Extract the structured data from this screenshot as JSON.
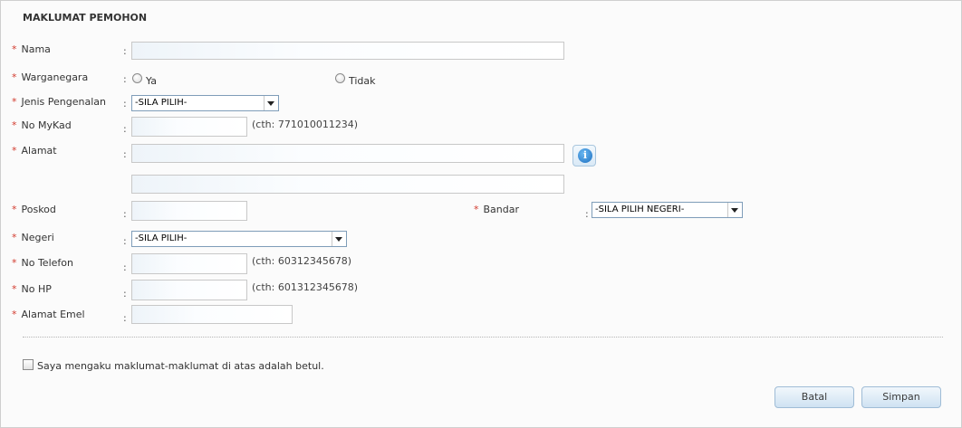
{
  "section_title": "MAKLUMAT PEMOHON",
  "required_mark": "*",
  "colon": ":",
  "fields": {
    "nama": {
      "label": "Nama"
    },
    "warganegara": {
      "label": "Warganegara",
      "options": [
        "Ya",
        "Tidak"
      ]
    },
    "jenis_pengenalan": {
      "label": "Jenis Pengenalan",
      "selected": "-SILA PILIH-"
    },
    "no_mykad": {
      "label": "No MyKad",
      "hint": "(cth: 771010011234)"
    },
    "alamat": {
      "label": "Alamat"
    },
    "poskod": {
      "label": "Poskod"
    },
    "bandar": {
      "label": "Bandar",
      "selected": "-SILA PILIH NEGERI-"
    },
    "negeri": {
      "label": "Negeri",
      "selected": "-SILA PILIH-"
    },
    "no_telefon": {
      "label": "No Telefon",
      "hint": "(cth: 60312345678)"
    },
    "no_hp": {
      "label": "No HP",
      "hint": "(cth: 601312345678)"
    },
    "alamat_emel": {
      "label": "Alamat Emel"
    }
  },
  "declaration": "Saya mengaku maklumat-maklumat di atas adalah betul.",
  "buttons": {
    "cancel": "Batal",
    "save": "Simpan"
  },
  "icons": {
    "info": "info-icon"
  },
  "colors": {
    "required": "#d23b2e",
    "button_border": "#9fbcd6",
    "panel_bg": "#fbfbfb"
  }
}
